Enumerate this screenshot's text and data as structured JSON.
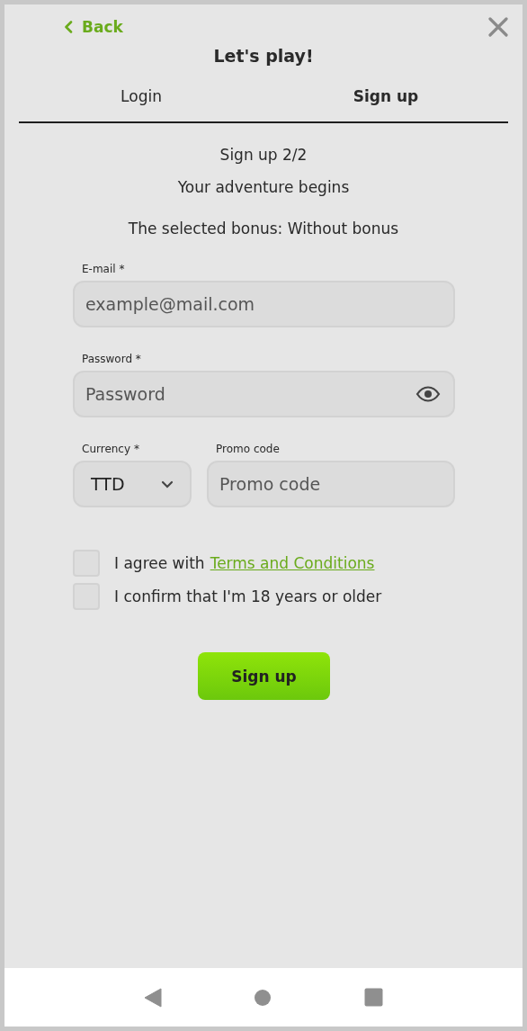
{
  "header": {
    "back": "Back",
    "title": "Let's play!"
  },
  "tabs": [
    {
      "label": "Login",
      "selected": false
    },
    {
      "label": "Sign up",
      "selected": true
    }
  ],
  "step": "Sign up 2/2",
  "subtitle": "Your adventure begins",
  "bonus": "The selected bonus: Without bonus",
  "email": {
    "label": "E-mail *",
    "placeholder": "example@mail.com"
  },
  "password": {
    "label": "Password *",
    "placeholder": "Password"
  },
  "currency": {
    "label": "Currency *",
    "value": "TTD"
  },
  "promo": {
    "label": "Promo code",
    "placeholder": "Promo code"
  },
  "agreements": [
    {
      "text": "I agree with",
      "link": "Terms and Conditions",
      "checked": false
    },
    {
      "text": "I confirm that I'm 18 years or older",
      "checked": false
    }
  ],
  "submit": "Sign up"
}
